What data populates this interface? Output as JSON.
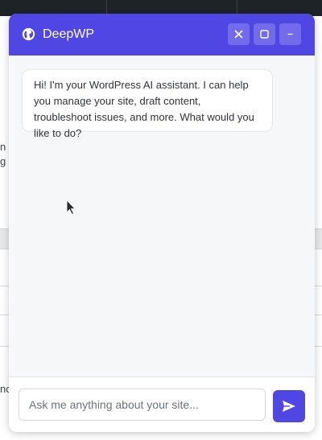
{
  "background": {
    "text_fragments": [
      "n",
      "g",
      "no"
    ]
  },
  "widget": {
    "title": "DeepWP",
    "header_icons": {
      "logo": "globe-icon",
      "close": "close-icon",
      "maximize": "maximize-icon",
      "minimize": "minimize-icon"
    },
    "colors": {
      "header": "#5046e4",
      "send_button": "#5046e4",
      "panel_bg": "#f6f7f9"
    },
    "messages": [
      {
        "role": "assistant",
        "text": "Hi! I'm your WordPress AI assistant. I can help you manage your site, draft content, troubleshoot issues, and more. What would you like to do?"
      }
    ],
    "composer": {
      "placeholder": "Ask me anything about your site...",
      "value": "",
      "send_icon": "send-icon"
    }
  }
}
